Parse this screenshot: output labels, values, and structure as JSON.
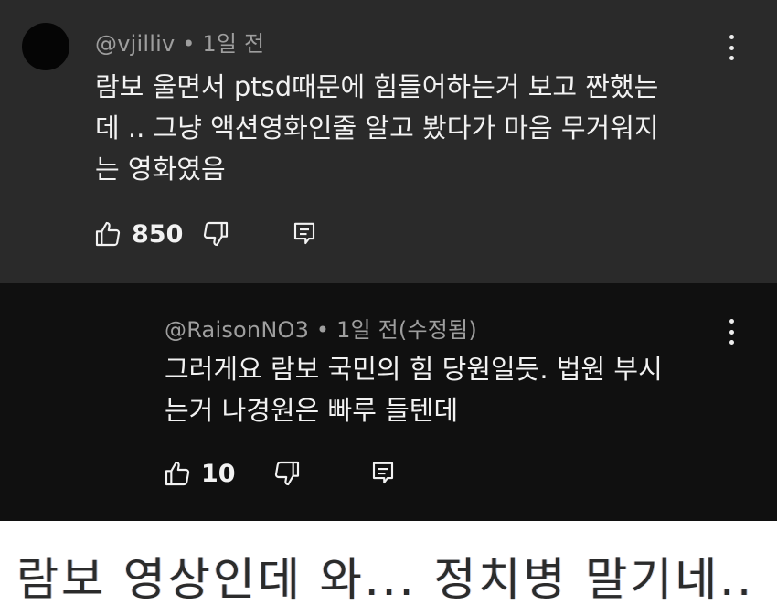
{
  "comment": {
    "handle": "@vjilliv",
    "time": "1일 전",
    "text": "람보 울면서 ptsd때문에 힘들어하는거 보고 짠했는\n데 .. 그냥 액션영화인줄 알고 봤다가 마음 무거워지\n는 영화였음",
    "likes": "850"
  },
  "reply": {
    "handle": "@RaisonNO3",
    "time": "1일 전(수정됨)",
    "text": "그러게요 람보 국민의 힘 당원일듯. 법원 부시\n는거  나경원은 빠루 들텐데",
    "likes": "10"
  },
  "caption": {
    "text": "람보 영상인데 와... 정치병 말기네.."
  },
  "icons": {
    "like": "thumb-up-icon",
    "dislike": "thumb-down-icon",
    "reply": "reply-comment-icon",
    "more": "more-vertical-icon"
  },
  "colors": {
    "comment_bg": "#2a2a2a",
    "reply_bg": "#101010",
    "meta_text": "#9e9e9e",
    "body_text": "#f2f2f2"
  }
}
